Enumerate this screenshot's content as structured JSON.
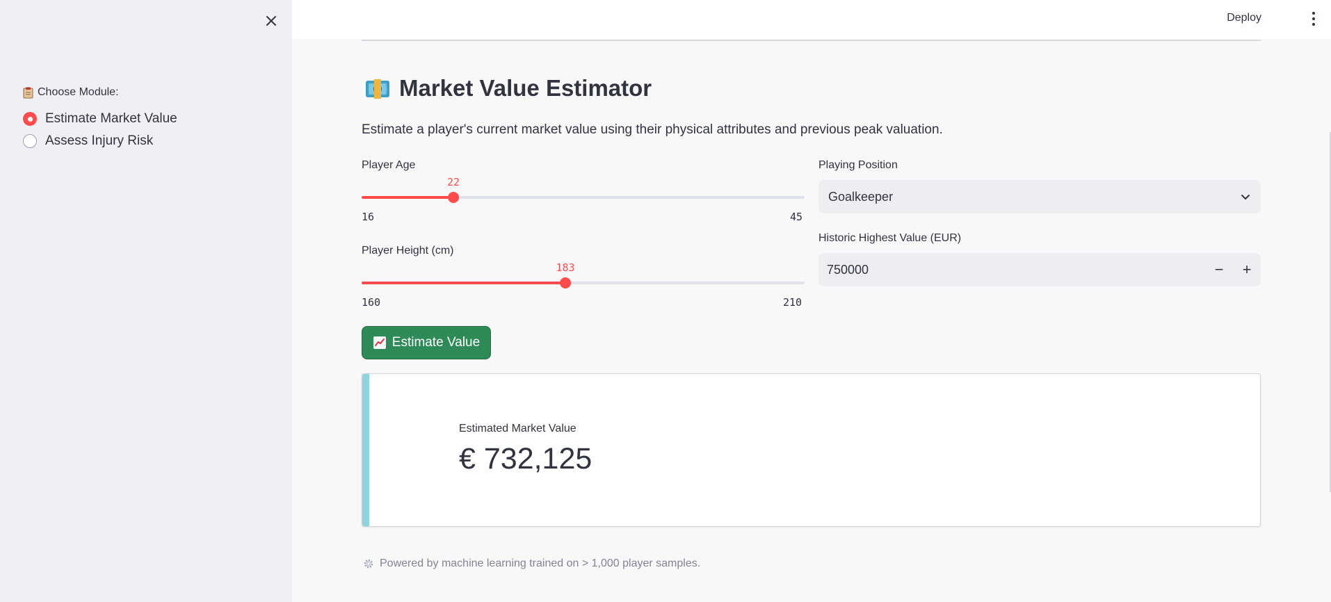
{
  "sidebar": {
    "close_label": "×",
    "module_label": "Choose Module:",
    "options": [
      {
        "label": "Estimate Market Value",
        "selected": true
      },
      {
        "label": "Assess Injury Risk",
        "selected": false
      }
    ]
  },
  "header": {
    "deploy_label": "Deploy",
    "menu_icon": "kebab-menu-icon"
  },
  "main": {
    "title": "Market Value Estimator",
    "title_icon": "money-icon",
    "subtitle": "Estimate a player's current market value using their physical attributes and previous peak valuation.",
    "age_slider": {
      "label": "Player Age",
      "value": "22",
      "min": "16",
      "max": "45"
    },
    "height_slider": {
      "label": "Player Height (cm)",
      "value": "183",
      "min": "160",
      "max": "210"
    },
    "position_select": {
      "label": "Playing Position",
      "value": "Goalkeeper"
    },
    "historic_value": {
      "label": "Historic Highest Value (EUR)",
      "value": "750000",
      "minus": "−",
      "plus": "+"
    },
    "estimate_button": "Estimate Value",
    "result": {
      "label": "Estimated Market Value",
      "value": "€ 732,125"
    },
    "footer": "Powered by machine learning trained on > 1,000 player samples."
  },
  "colors": {
    "accent": "#ff4b4b",
    "button": "#2e8b57",
    "result_accent": "#8fd3df",
    "sidebar_bg": "#eef0f4"
  }
}
